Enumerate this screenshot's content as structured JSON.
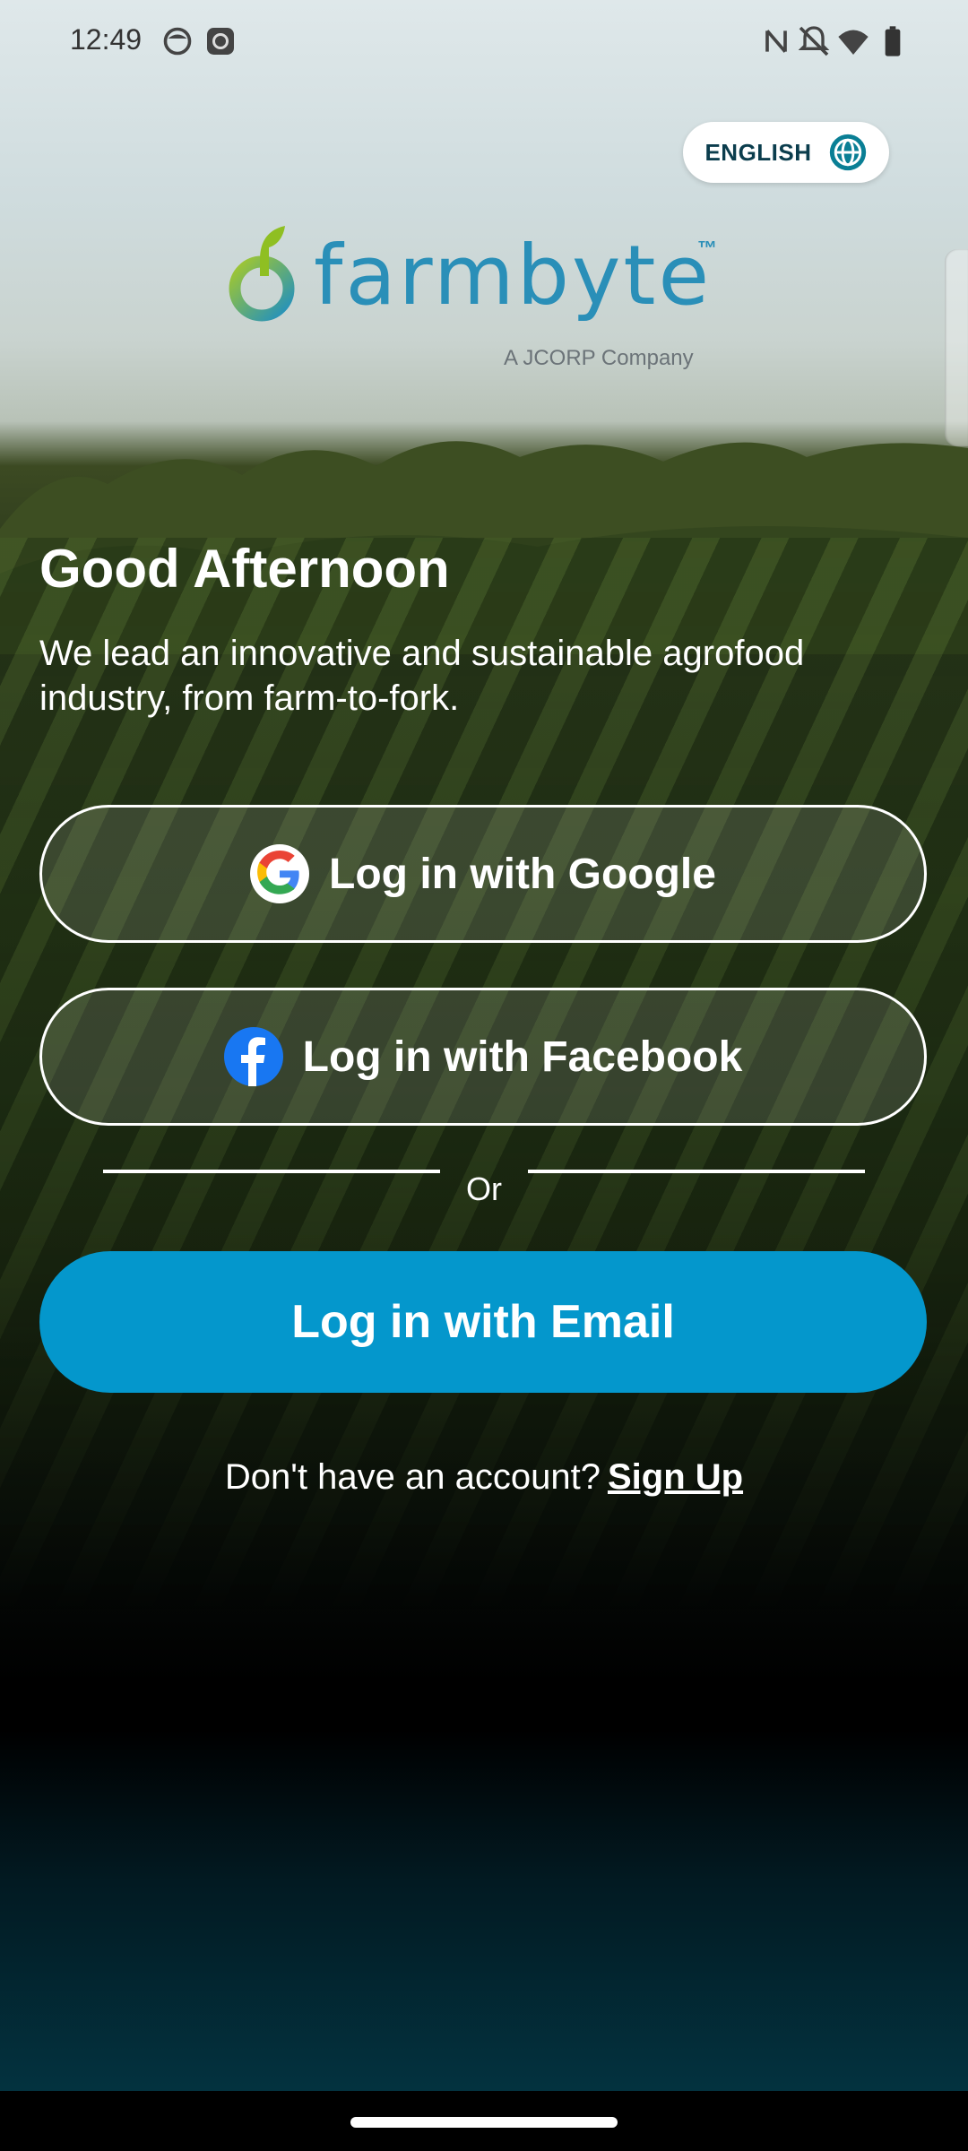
{
  "status_bar": {
    "time": "12:49"
  },
  "language": {
    "label": "ENGLISH"
  },
  "logo": {
    "wordmark": "farmbyte",
    "tm": "™",
    "sub": "A JCORP Company"
  },
  "greeting": "Good Afternoon",
  "tagline": "We lead an innovative and sustainable agrofood industry, from farm-to-fork.",
  "buttons": {
    "google": "Log in with Google",
    "facebook": "Log in with Facebook",
    "email": "Log in with Email"
  },
  "divider_text": "Or",
  "signup": {
    "prompt": "Don't have an account?",
    "link": "Sign Up"
  },
  "colors": {
    "primary": "#0497cc",
    "brand_text": "#2a8fb8"
  }
}
